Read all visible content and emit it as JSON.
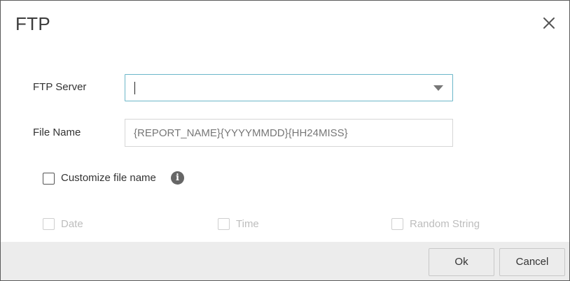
{
  "dialog": {
    "title": "FTP",
    "close_icon": "close-icon"
  },
  "form": {
    "ftp_server": {
      "label": "FTP Server",
      "value": "",
      "dropdown_icon": "caret-down-icon"
    },
    "file_name": {
      "label": "File Name",
      "value": "{REPORT_NAME}{YYYYMMDD}{HH24MISS}"
    },
    "customize": {
      "label": "Customize file name",
      "checked": false,
      "info_icon": "info-icon",
      "info_glyph": "i"
    },
    "options": [
      {
        "label": "Date",
        "checked": false,
        "disabled": true
      },
      {
        "label": "Time",
        "checked": false,
        "disabled": true
      },
      {
        "label": "Random String",
        "checked": false,
        "disabled": true
      }
    ]
  },
  "footer": {
    "ok_label": "Ok",
    "cancel_label": "Cancel"
  },
  "colors": {
    "focus_border": "#6bb7c9",
    "footer_bg": "#ececec",
    "disabled_text": "#bdbdbd"
  }
}
